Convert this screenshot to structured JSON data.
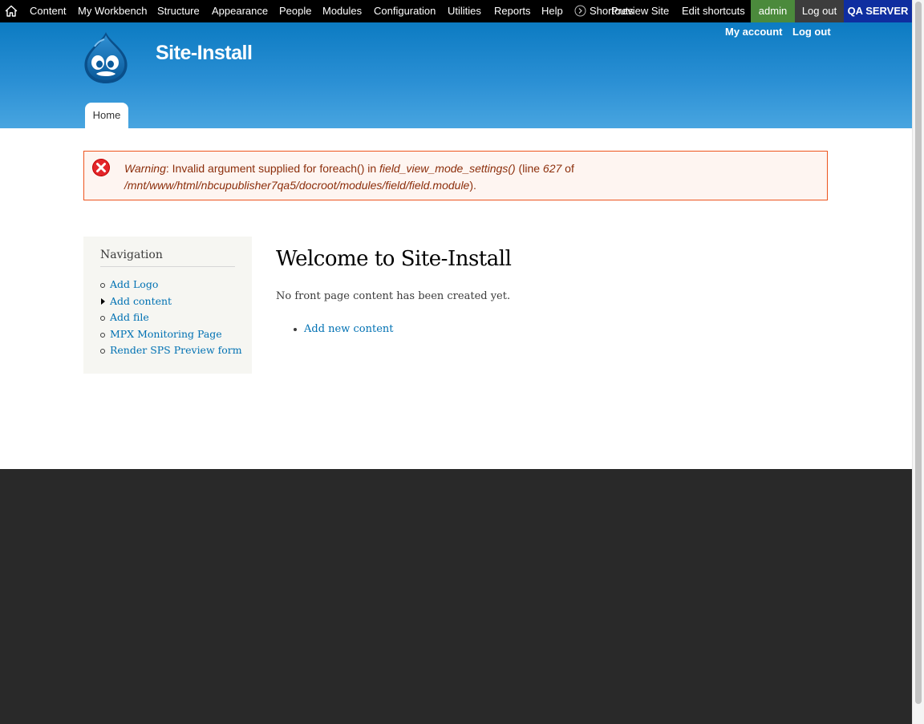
{
  "toolbar": {
    "items": [
      "Content",
      "My Workbench",
      "Structure",
      "Appearance",
      "People",
      "Modules",
      "Configuration",
      "Utilities",
      "Reports",
      "Help"
    ],
    "shortcuts_label": "Shortcuts",
    "preview_site": "Preview Site",
    "edit_shortcuts": "Edit shortcuts",
    "user": "admin",
    "logout": "Log out",
    "server_badge": "QA SERVER",
    "colors": {
      "user_bg": "#4b8a3c",
      "logout_bg": "#3d3d3d",
      "server_bg": "#0f2ea0"
    }
  },
  "header": {
    "site_name": "Site-Install",
    "secondary_links": [
      "My account",
      "Log out"
    ],
    "tab_home": "Home"
  },
  "warning": {
    "type": "Warning",
    "text_1": ": Invalid argument supplied for foreach() in ",
    "function": "field_view_mode_settings()",
    "text_2": " (line ",
    "line": "627",
    "text_3": " of ",
    "path": "/mnt/www/html/nbcupublisher7qa5/docroot/modules/field/field.module",
    "text_4": ")."
  },
  "sidebar": {
    "title": "Navigation",
    "items": [
      {
        "label": "Add Logo",
        "bullet": "circle"
      },
      {
        "label": "Add content",
        "bullet": "arrow"
      },
      {
        "label": "Add file",
        "bullet": "circle"
      },
      {
        "label": "MPX Monitoring Page",
        "bullet": "circle"
      },
      {
        "label": "Render SPS Preview form",
        "bullet": "circle"
      }
    ]
  },
  "main": {
    "title": "Welcome to Site-Install",
    "no_content": "No front page content has been created yet.",
    "add_new": "Add new content"
  }
}
